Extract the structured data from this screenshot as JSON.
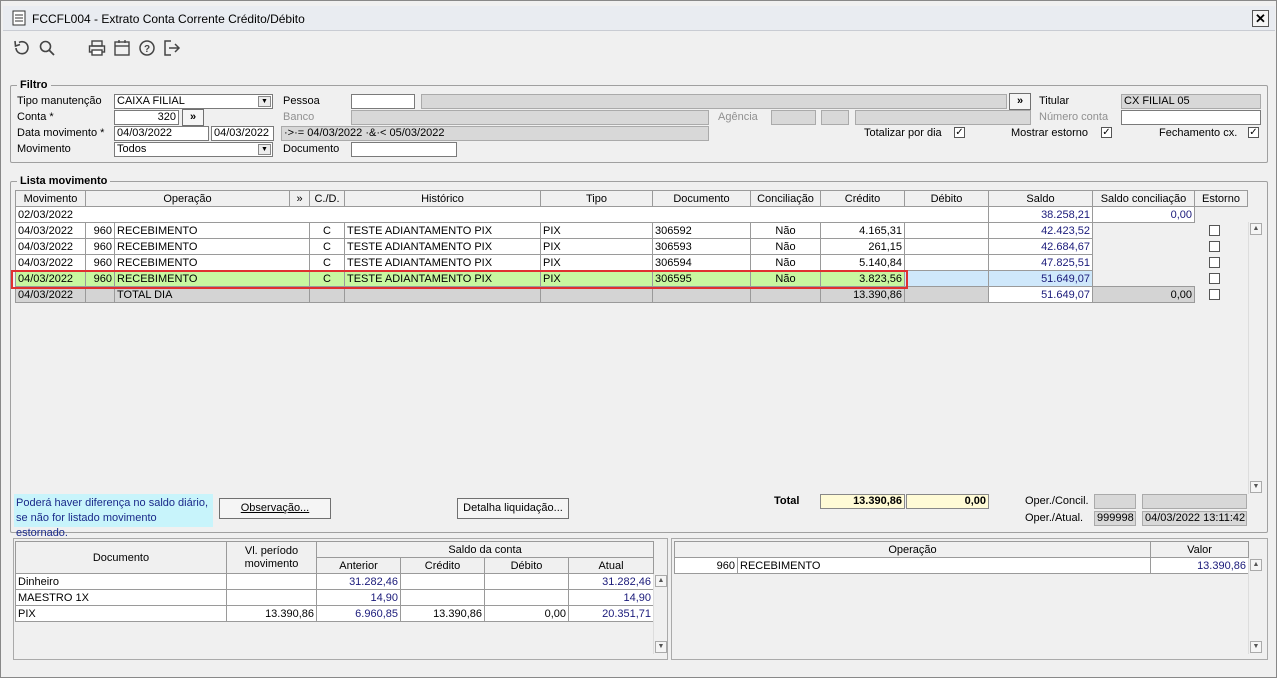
{
  "window": {
    "title": "FCCFL004 - Extrato Conta Corrente Crédito/Débito",
    "close": "✕"
  },
  "toolbar": {
    "undo": "↺",
    "search": "🔍",
    "print": "🖨",
    "calendar": "📅",
    "help": "?",
    "exit": "↦"
  },
  "filtro": {
    "legend": "Filtro",
    "tipo_manutencao_label": "Tipo manutenção",
    "tipo_manutencao_value": "CAIXA FILIAL",
    "conta_label": "Conta *",
    "conta_value": "320",
    "conta_btn": "»",
    "data_mov_label": "Data movimento *",
    "data_from": "04/03/2022",
    "data_to": "04/03/2022",
    "data_expr": "·>·= 04/03/2022 ·&·< 05/03/2022",
    "movimento_label": "Movimento",
    "movimento_value": "Todos",
    "pessoa_label": "Pessoa",
    "pessoa_btn": "»",
    "banco_label": "Banco",
    "agencia_label": "Agência",
    "documento_label": "Documento",
    "titular_label": "Titular",
    "titular_value": "CX FILIAL 05",
    "numero_conta_label": "Número conta",
    "totalizar_label": "Totalizar por dia",
    "mostrar_estorno_label": "Mostrar estorno",
    "fechamento_label": "Fechamento cx.",
    "check": "✓"
  },
  "lista": {
    "legend": "Lista movimento",
    "headers": [
      "Movimento",
      "Operação",
      "»",
      "C./D.",
      "Histórico",
      "Tipo",
      "Documento",
      "Conciliação",
      "Crédito",
      "Débito",
      "Saldo",
      "Saldo conciliação",
      "Estorno"
    ],
    "first_row": {
      "date": "02/03/2022",
      "saldo": "38.258,21",
      "saldo_conc": "0,00"
    },
    "rows": [
      {
        "mov": "04/03/2022",
        "cod": "960",
        "op": "RECEBIMENTO",
        "cd": "C",
        "hist": "TESTE ADIANTAMENTO PIX",
        "tipo": "PIX",
        "doc": "306592",
        "conc": "Não",
        "cred": "4.165,31",
        "deb": "",
        "saldo": "42.423,52"
      },
      {
        "mov": "04/03/2022",
        "cod": "960",
        "op": "RECEBIMENTO",
        "cd": "C",
        "hist": "TESTE ADIANTAMENTO PIX",
        "tipo": "PIX",
        "doc": "306593",
        "conc": "Não",
        "cred": "261,15",
        "deb": "",
        "saldo": "42.684,67"
      },
      {
        "mov": "04/03/2022",
        "cod": "960",
        "op": "RECEBIMENTO",
        "cd": "C",
        "hist": "TESTE ADIANTAMENTO PIX",
        "tipo": "PIX",
        "doc": "306594",
        "conc": "Não",
        "cred": "5.140,84",
        "deb": "",
        "saldo": "47.825,51"
      },
      {
        "mov": "04/03/2022",
        "cod": "960",
        "op": "RECEBIMENTO",
        "cd": "C",
        "hist": "TESTE ADIANTAMENTO PIX",
        "tipo": "PIX",
        "doc": "306595",
        "conc": "Não",
        "cred": "3.823,56",
        "deb": "",
        "saldo": "51.649,07"
      }
    ],
    "total_row": {
      "mov": "04/03/2022",
      "op": "TOTAL DIA",
      "cred": "13.390,86",
      "saldo": "51.649,07",
      "saldo_conc": "0,00"
    }
  },
  "bottom": {
    "note_line1": "Poderá haver diferença no saldo diário,",
    "note_line2": "se não for listado movimento estornado.",
    "observacao_btn": "Observação...",
    "detalha_btn": "Detalha liquidação...",
    "total_label": "Total",
    "total_credito": "13.390,86",
    "total_debito": "0,00",
    "oper_concil_label": "Oper./Concil.",
    "oper_atual_label": "Oper./Atual.",
    "oper_atual_code": "999998",
    "oper_atual_datetime": "04/03/2022 13:11:42"
  },
  "doc_table": {
    "h_documento": "Documento",
    "h_vl_periodo": "Vl. período movimento",
    "h_saldo": "Saldo da conta",
    "h_anterior": "Anterior",
    "h_credito": "Crédito",
    "h_debito": "Débito",
    "h_atual": "Atual",
    "rows": [
      {
        "doc": "Dinheiro",
        "vl": "",
        "ant": "31.282,46",
        "cred": "",
        "deb": "",
        "atual": "31.282,46"
      },
      {
        "doc": "MAESTRO 1X",
        "vl": "",
        "ant": "14,90",
        "cred": "",
        "deb": "",
        "atual": "14,90"
      },
      {
        "doc": "PIX",
        "vl": "13.390,86",
        "ant": "6.960,85",
        "cred": "13.390,86",
        "deb": "0,00",
        "atual": "20.351,71"
      }
    ]
  },
  "op_table": {
    "h_operacao": "Operação",
    "h_valor": "Valor",
    "rows": [
      {
        "cod": "960",
        "op": "RECEBIMENTO",
        "valor": "13.390,86"
      }
    ]
  },
  "colors": {
    "selected_row": "#c8f7a0",
    "highlight_border": "#e03030",
    "note_bg": "#c8f4fb",
    "total_bg": "#fffbd6"
  }
}
